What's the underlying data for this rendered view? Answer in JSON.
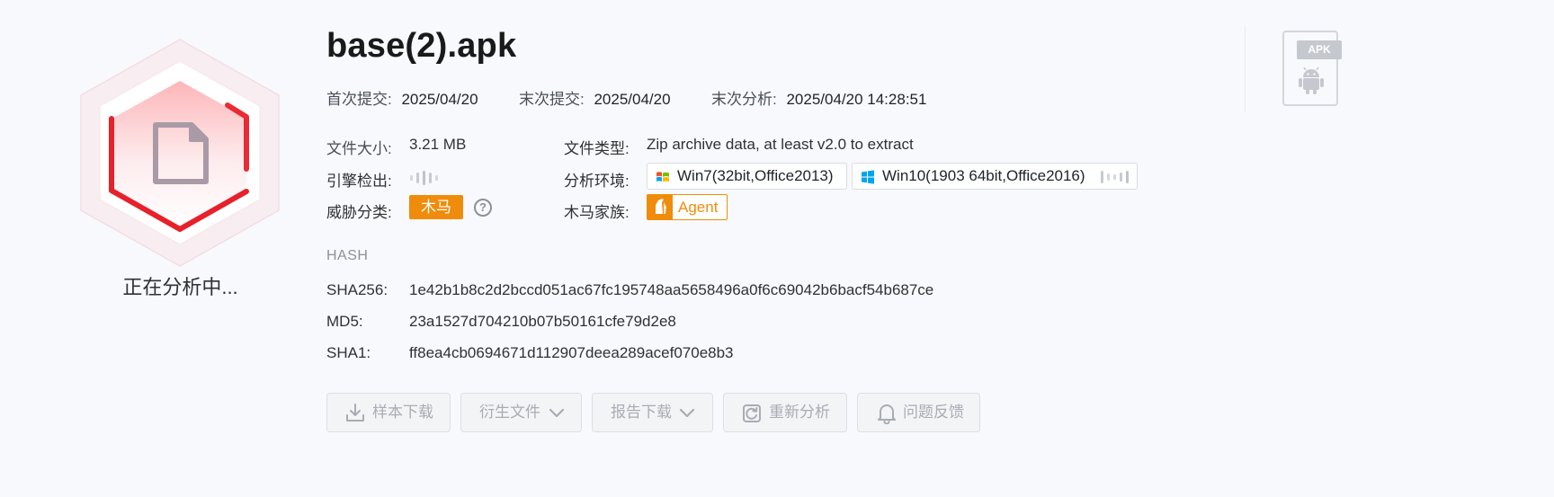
{
  "status": {
    "text": "正在分析中..."
  },
  "file": {
    "name": "base(2).apk"
  },
  "dates": [
    {
      "label": "首次提交:",
      "value": "2025/04/20"
    },
    {
      "label": "末次提交:",
      "value": "2025/04/20"
    },
    {
      "label": "末次分析:",
      "value": "2025/04/20 14:28:51"
    }
  ],
  "info": {
    "size_label": "文件大小:",
    "size_value": "3.21 MB",
    "type_label": "文件类型:",
    "type_value": "Zip archive data, at least v2.0 to extract",
    "engine_label": "引擎检出:",
    "env_label": "分析环境:",
    "env": [
      "Win7(32bit,Office2013)",
      "Win10(1903 64bit,Office2016)"
    ],
    "threat_label": "威胁分类:",
    "threat_value": "木马",
    "family_label": "木马家族:",
    "family_value": "Agent"
  },
  "hash": {
    "header": "HASH",
    "sha256_label": "SHA256:",
    "sha256": "1e42b1b8c2d2bccd051ac67fc195748aa5658496a0f6c69042b6bacf54b687ce",
    "md5_label": "MD5:",
    "md5": "23a1527d704210b07b50161cfe79d2e8",
    "sha1_label": "SHA1:",
    "sha1": "ff8ea4cb0694671d112907deea289acef070e8b3"
  },
  "badge": {
    "apk": "APK"
  },
  "help": "?",
  "actions": [
    "样本下载",
    "衍生文件",
    "报告下载",
    "重新分析",
    "问题反馈"
  ],
  "colors": {
    "accent": "#ef8c0b",
    "danger": "#e8202a"
  }
}
